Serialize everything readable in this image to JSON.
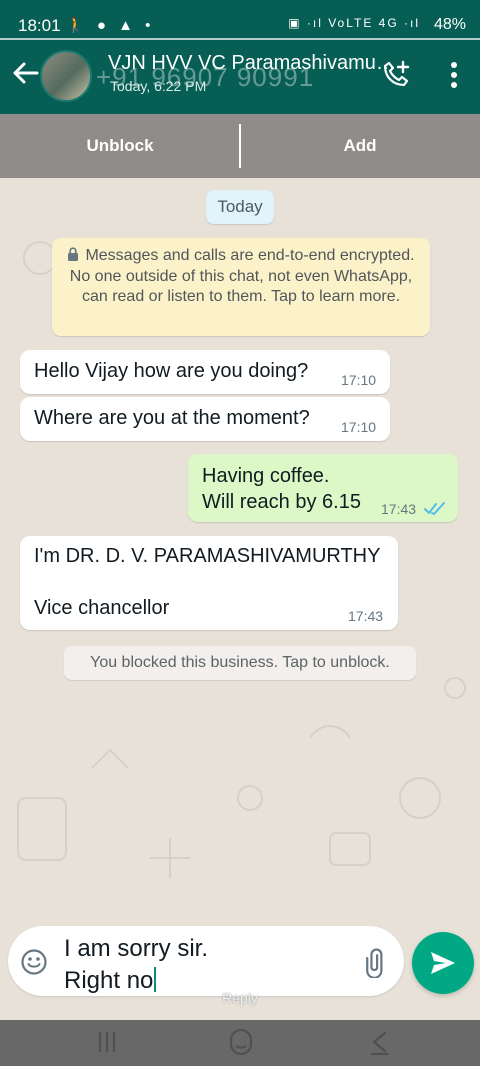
{
  "status_bar": {
    "time": "18:01",
    "left_icons": "🚶 ● ▲ •",
    "right_icons": "▣ ·ıl VoLTE 4G ·ıl",
    "battery": "48%"
  },
  "app_bar": {
    "contact_name": "VJN HVV VC Paramashivamur...",
    "contact_number": "+91 96907 90991",
    "last_seen": "Today, 6:22 PM"
  },
  "actions": {
    "unblock": "Unblock",
    "add": "Add"
  },
  "chat": {
    "date_label": "Today",
    "encryption_notice": "Messages and calls are end-to-end encrypted. No one outside of this chat, not even WhatsApp, can read or listen to them. Tap to learn more.",
    "messages": [
      {
        "direction": "incoming",
        "text": "Hello Vijay how are you doing?",
        "time": "17:10"
      },
      {
        "direction": "incoming",
        "text": "Where are you at the moment?",
        "time": "17:10"
      },
      {
        "direction": "outgoing",
        "text": "Having coffee.\nWill reach by 6.15",
        "time": "17:43",
        "status": "read"
      },
      {
        "direction": "incoming",
        "text": "I'm DR. D. V. PARAMASHIVAMURTHY\n\nVice chancellor",
        "time": "17:43"
      }
    ],
    "blocked_notice": "You blocked this business. Tap to unblock."
  },
  "composer": {
    "input_value": "I am sorry sir.\nRight no",
    "reply_label": "Reply"
  },
  "colors": {
    "header": "#075e54",
    "send": "#00a884",
    "incoming_bubble": "#ffffff",
    "outgoing_bubble": "#dcf8c6",
    "encryption_bubble": "#fbf2c9",
    "read_ticks": "#53bdeb"
  },
  "icons": {
    "back": "back-arrow-icon",
    "call": "add-call-icon",
    "more": "more-vert-icon",
    "lock": "lock-icon",
    "emoji": "emoji-icon",
    "attach": "paperclip-icon",
    "send": "send-icon",
    "read": "double-check-icon"
  }
}
